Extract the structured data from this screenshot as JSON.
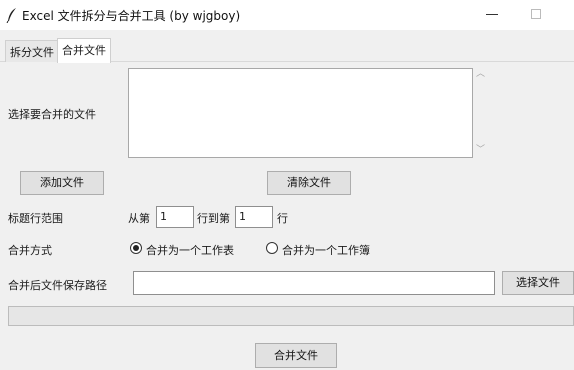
{
  "window": {
    "title": "Excel 文件拆分与合并工具 (by wjgboy)"
  },
  "tabs": [
    {
      "label": "拆分文件",
      "active": false
    },
    {
      "label": "合并文件",
      "active": true
    }
  ],
  "merge": {
    "select_files_label": "选择要合并的文件",
    "files": [],
    "add_button": "添加文件",
    "clear_button": "清除文件",
    "header_range_label": "标题行范围",
    "from_label": "从第",
    "from_value": "1",
    "to_label": "行到第",
    "to_value": "1",
    "row_suffix": "行",
    "mode_label": "合并方式",
    "modes": [
      {
        "label": "合并为一个工作表",
        "selected": true
      },
      {
        "label": "合并为一个工作簿",
        "selected": false
      }
    ],
    "save_path_label": "合并后文件保存路径",
    "save_path_value": "",
    "browse_button": "选择文件",
    "progress": 0,
    "merge_button": "合并文件"
  }
}
